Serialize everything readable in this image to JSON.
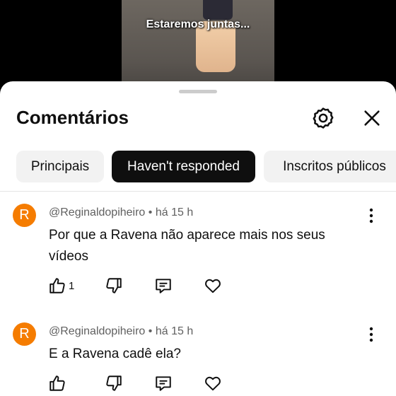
{
  "video": {
    "caption": "Estaremos juntas..."
  },
  "panel": {
    "title": "Comentários"
  },
  "chips": [
    "Principais",
    "Haven't responded",
    "Inscritos públicos"
  ],
  "colors": {
    "avatar": "#f57c00",
    "active_chip": "#0f0f0f"
  },
  "comments": [
    {
      "avatar_letter": "R",
      "author": "@Reginaldopiheiro",
      "separator": "•",
      "time": "há 15 h",
      "text": "Por que a Ravena não aparece mais nos seus vídeos",
      "likes": "1"
    },
    {
      "avatar_letter": "R",
      "author": "@Reginaldopiheiro",
      "separator": "•",
      "time": "há 15 h",
      "text": "E a Ravena cadê ela?",
      "likes": ""
    }
  ],
  "icons": [
    "settings-icon",
    "close-icon",
    "more-icon",
    "like-icon",
    "dislike-icon",
    "reply-icon",
    "heart-icon"
  ]
}
